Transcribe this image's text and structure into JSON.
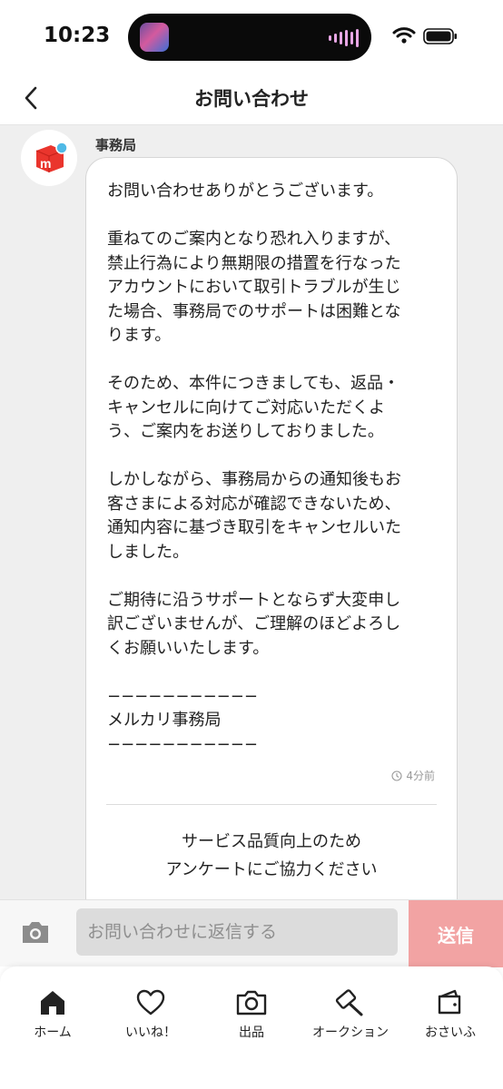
{
  "status_bar": {
    "time": "10:23"
  },
  "header": {
    "title": "お問い合わせ"
  },
  "message": {
    "sender": "事務局",
    "body": "お問い合わせありがとうございます。\n\n重ねてのご案内となり恐れ入りますが、\n禁止行為により無期限の措置を行なった\nアカウントにおいて取引トラブルが生じ\nた場合、事務局でのサポートは困難とな\nります。\n\nそのため、本件につきましても、返品・\nキャンセルに向けてご対応いただくよ\nう、ご案内をお送りしておりました。\n\nしかしながら、事務局からの通知後もお\n客さまによる対応が確認できないため、\n通知内容に基づき取引をキャンセルいた\nしました。\n\nご期待に沿うサポートとならず大変申し\n訳ございませんが、ご理解のほどよろし\nくお願いいたします。\n\n−−−−−−−−−−−\nメルカリ事務局\n−−−−−−−−−−−",
    "timestamp": "4分前",
    "survey_text": "サービス品質向上のため\nアンケートにご協力ください"
  },
  "input": {
    "placeholder": "お問い合わせに返信する",
    "send_label": "送信"
  },
  "tabs": [
    {
      "label": "ホーム",
      "icon": "home-icon"
    },
    {
      "label": "いいね！",
      "icon": "heart-icon"
    },
    {
      "label": "出品",
      "icon": "camera-icon"
    },
    {
      "label": "オークション",
      "icon": "gavel-icon"
    },
    {
      "label": "おさいふ",
      "icon": "wallet-icon"
    }
  ],
  "colors": {
    "brand_red": "#ea352d",
    "send_button": "#f2a3a3",
    "chat_background": "#efefef"
  }
}
